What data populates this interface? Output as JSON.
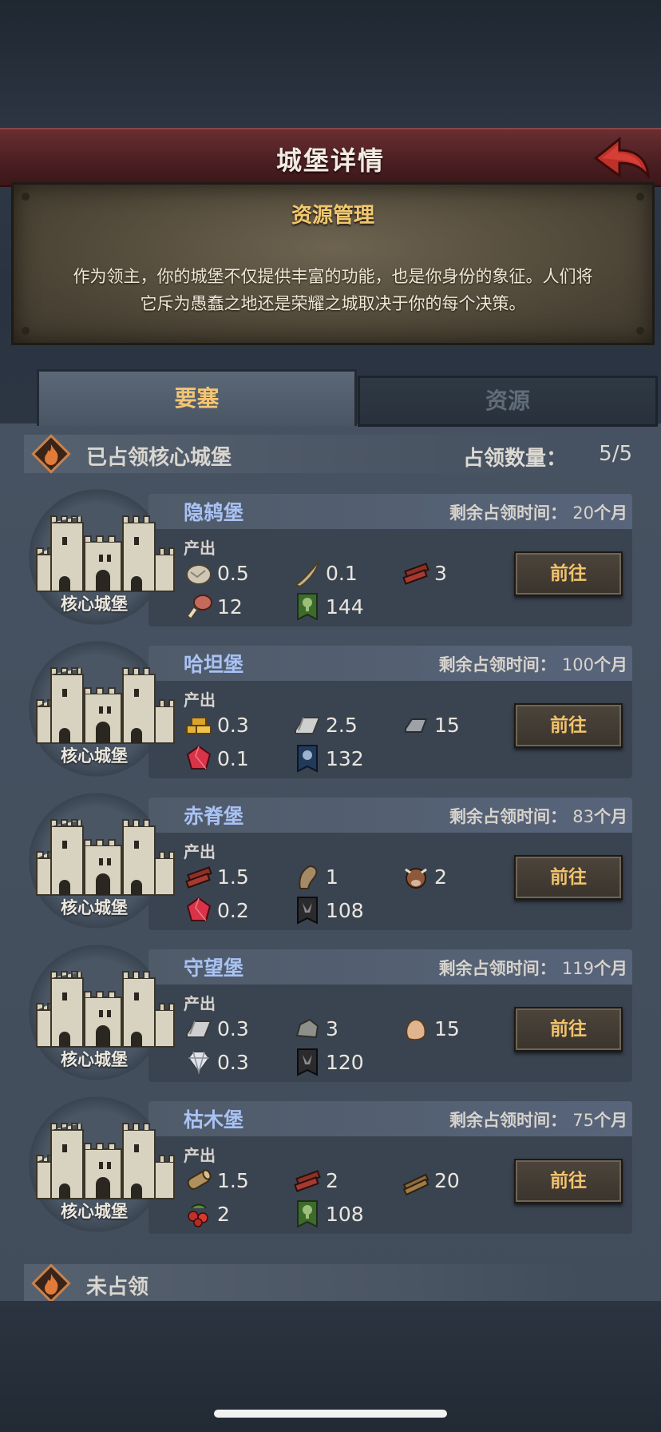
{
  "header": {
    "title": "城堡详情"
  },
  "info": {
    "subtitle": "资源管理",
    "description_line1": "作为领主，你的城堡不仅提供丰富的功能，也是你身份的象征。人们将",
    "description_line2": "它斥为愚蠢之地还是荣耀之城取决于你的每个决策。"
  },
  "tabs": [
    {
      "label": "要塞",
      "active": true
    },
    {
      "label": "资源",
      "active": false
    }
  ],
  "occupied_section": {
    "title": "已占领核心城堡",
    "count_label": "占领数量：",
    "count_value": "5/5"
  },
  "unoccupied_section": {
    "title": "未占领"
  },
  "card_common": {
    "core_label": "核心城堡",
    "produce_label": "产出",
    "remaining_label": "剩余占领时间：",
    "month_unit": "个月",
    "go_label": "前往"
  },
  "castles": [
    {
      "name": "隐鸫堡",
      "remaining": "20",
      "resources": [
        {
          "icon": "ore-icon",
          "value": "0.5"
        },
        {
          "icon": "horn-icon",
          "value": "0.1"
        },
        {
          "icon": "wood-planks-icon",
          "value": "3"
        },
        {
          "icon": "meat-icon",
          "value": "12"
        },
        {
          "icon": "tree-banner-icon",
          "value": "144"
        }
      ]
    },
    {
      "name": "哈坦堡",
      "remaining": "100",
      "resources": [
        {
          "icon": "gold-bars-icon",
          "value": "0.3"
        },
        {
          "icon": "silver-ingot-icon",
          "value": "2.5"
        },
        {
          "icon": "iron-ingot-icon",
          "value": "15"
        },
        {
          "icon": "ruby-icon",
          "value": "0.1"
        },
        {
          "icon": "blue-banner-icon",
          "value": "132"
        }
      ]
    },
    {
      "name": "赤脊堡",
      "remaining": "83",
      "resources": [
        {
          "icon": "wood-planks-icon",
          "value": "1.5"
        },
        {
          "icon": "horse-icon",
          "value": "1"
        },
        {
          "icon": "cattle-icon",
          "value": "2"
        },
        {
          "icon": "ruby-icon",
          "value": "0.2"
        },
        {
          "icon": "dark-banner-icon",
          "value": "108"
        }
      ]
    },
    {
      "name": "守望堡",
      "remaining": "119",
      "resources": [
        {
          "icon": "silver-ingot-icon",
          "value": "0.3"
        },
        {
          "icon": "stone-icon",
          "value": "3"
        },
        {
          "icon": "leather-icon",
          "value": "15"
        },
        {
          "icon": "diamond-icon",
          "value": "0.3"
        },
        {
          "icon": "dark-banner-icon",
          "value": "120"
        }
      ]
    },
    {
      "name": "枯木堡",
      "remaining": "75",
      "resources": [
        {
          "icon": "log-icon",
          "value": "1.5"
        },
        {
          "icon": "wood-planks-icon",
          "value": "2"
        },
        {
          "icon": "lumber-icon",
          "value": "20"
        },
        {
          "icon": "berries-icon",
          "value": "2"
        },
        {
          "icon": "tree-banner-icon",
          "value": "108"
        }
      ]
    }
  ]
}
